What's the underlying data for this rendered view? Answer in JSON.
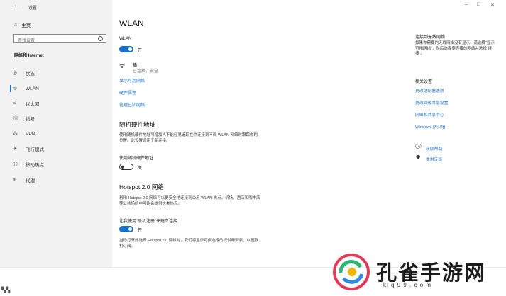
{
  "window": {
    "title": "设置",
    "back_icon": "arrow-left-icon",
    "minimize": "–",
    "maximize": "□",
    "close": "✕"
  },
  "sidebar": {
    "home_label": "主页",
    "search_placeholder": "查找设置",
    "section_title": "网络和 Internet",
    "items": [
      {
        "label": "状态",
        "icon": "globe-icon",
        "glyph": "◎"
      },
      {
        "label": "WLAN",
        "icon": "wifi-icon",
        "glyph": "ᯤ"
      },
      {
        "label": "以太网",
        "icon": "ethernet-icon",
        "glyph": "⌸"
      },
      {
        "label": "拨号",
        "icon": "dialup-icon",
        "glyph": "☏"
      },
      {
        "label": "VPN",
        "icon": "vpn-icon",
        "glyph": "⁂"
      },
      {
        "label": "飞行模式",
        "icon": "airplane-icon",
        "glyph": "✈"
      },
      {
        "label": "移动热点",
        "icon": "hotspot-icon",
        "glyph": "((·))"
      },
      {
        "label": "代理",
        "icon": "proxy-icon",
        "glyph": "⊕"
      }
    ],
    "active_index": 1
  },
  "main": {
    "title": "WLAN",
    "wlan_label": "WLAN",
    "wlan_state": "开",
    "network_name": "猫",
    "network_status": "已连接，安全",
    "links": [
      "显示可用网络",
      "硬件属性",
      "管理已知网络"
    ],
    "random_mac": {
      "title": "随机硬件地址",
      "description": "使用随机硬件地址可增加人不能轻易追踪在你连接到不同 WLAN 网络时跟踪你的位置。此设置适用于新连接。",
      "toggle_label": "使用随机硬件地址",
      "toggle_state": "关"
    },
    "hotspot": {
      "title": "Hotspot 2.0 网络",
      "description": "利用 Hotspot 2.0 网络可以更安全地连接到公用 WLAN 热点。机场、酒店和咖啡店等公共场所中可能会提供这类热点。",
      "toggle_label": "让我使用“联机注册”来建立连接",
      "toggle_state": "开",
      "footer": "当你打开此选择 Hotspot 2.0 网络时，我们将显示可供选择的提供商列表，以便联机订阅。"
    }
  },
  "right": {
    "wireless_title": "连接到无线网络",
    "wireless_desc": "如果你需要的无线网络没有显示，请选择“显示可用网络”，然后选择要连接的网络并选择“连接”。",
    "related_title": "相关设置",
    "related_links": [
      "更改适配器选项",
      "更改高级共享设置",
      "网络和共享中心",
      "Windows 防火墙"
    ],
    "help_links": [
      {
        "label": "获取帮助",
        "icon": "help-chat-icon"
      },
      {
        "label": "提供反馈",
        "icon": "feedback-person-icon"
      }
    ]
  },
  "watermark": {
    "text": "孔雀手游网",
    "domain": "kl q 9 9 . c o m"
  },
  "colors": {
    "accent": "#1a6fc9",
    "sidebar_bg": "#f2f2f2"
  }
}
